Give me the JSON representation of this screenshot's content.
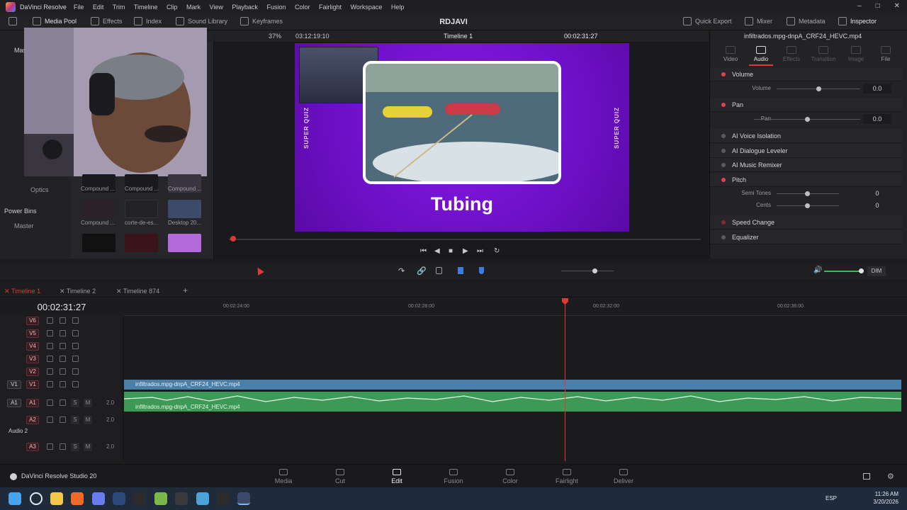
{
  "titlebar": {
    "app_name": "DaVinci Resolve",
    "menu": [
      "File",
      "Edit",
      "Trim",
      "Timeline",
      "Clip",
      "Mark",
      "View",
      "Playback",
      "Fusion",
      "Color",
      "Fairlight",
      "Workspace",
      "Help"
    ]
  },
  "toolbar": {
    "media_pool": "Media Pool",
    "effects": "Effects",
    "index": "Index",
    "sound_library": "Sound Library",
    "keyframes": "Keyframes",
    "project_title": "RDJAVI",
    "quick_export": "Quick Export",
    "mixer": "Mixer",
    "metadata": "Metadata",
    "inspector": "Inspector"
  },
  "media_pool": {
    "sidebar_truncated": "Mas",
    "optics": "Optics",
    "power_bins": "Power Bins",
    "master": "Master",
    "clips": [
      {
        "label": "Compound ...",
        "color": "#1a1a1c"
      },
      {
        "label": "Compound ...",
        "color": "#1a1a1c"
      },
      {
        "label": "Compound ...",
        "color": "#3a3440"
      },
      {
        "label": "Compound ...",
        "color": "#2a2226"
      },
      {
        "label": "corte-de-es...",
        "color": "#232326"
      },
      {
        "label": "Desktop 20...",
        "color": "#3d4a6a"
      },
      {
        "label": "",
        "color": "#111"
      },
      {
        "label": "",
        "color": "#3a1418"
      },
      {
        "label": "",
        "color": "#b46ad8"
      }
    ]
  },
  "viewer": {
    "zoom": "37%",
    "source_timecode": "03:12:19:10",
    "timeline_name": "Timeline 1",
    "record_timecode": "00:02:31:27",
    "overlay_title": "Tubing",
    "side_text": "SUPER QUIZ"
  },
  "inspector": {
    "clip_name": "infiltrados.mpg-dnpA_CRF24_HEVC.mp4",
    "tabs": [
      "Video",
      "Audio",
      "Effects",
      "Transition",
      "Image",
      "File"
    ],
    "active_tab": "Audio",
    "sections": {
      "volume": {
        "title": "Volume",
        "param": "Volume",
        "value": "0.0",
        "level": 0.5
      },
      "pan": {
        "title": "Pan",
        "param": "Pan",
        "value": "0.0",
        "level": 0.5
      },
      "voice_isolation": "AI Voice Isolation",
      "dialogue_leveler": "AI Dialogue Leveler",
      "music_remixer": "AI Music Remixer",
      "pitch": {
        "title": "Pitch",
        "semitones_label": "Semi Tones",
        "semitones_value": "0",
        "cents_label": "Cents",
        "cents_value": "0"
      },
      "speed_change": "Speed Change",
      "equalizer": "Equalizer"
    }
  },
  "timeline_toolbar": {
    "dim": "DIM"
  },
  "timeline_tabs": [
    "Timeline 1",
    "Timeline 2",
    "Timeline 874"
  ],
  "timeline": {
    "timecode": "00:02:31:27",
    "ruler": [
      "00:02:24:00",
      "00:02:28:00",
      "00:02:32:00",
      "00:02:36:00"
    ],
    "video_tracks": [
      "V6",
      "V5",
      "V4",
      "V3",
      "V2",
      "V1"
    ],
    "v1_button": "V1",
    "audio": {
      "a1_button": "A1",
      "a1": "A1",
      "a1_level": "2.0",
      "a2": "A2",
      "a2_level": "2.0",
      "a2_name": "Audio 2",
      "a3": "A3",
      "a3_level": "2.0",
      "solo": "S",
      "mute": "M"
    },
    "clip_video_name": "infiltrados.mpg-dnpA_CRF24_HEVC.mp4",
    "clip_audio_name": "infiltrados.mpg-dnpA_CRF24_HEVC.mp4"
  },
  "pagenav": {
    "brand": "DaVinci Resolve Studio 20",
    "pages": [
      "Media",
      "Cut",
      "Edit",
      "Fusion",
      "Color",
      "Fairlight",
      "Deliver"
    ],
    "active": "Edit"
  },
  "taskbar": {
    "lang": "ESP",
    "time": "11:26 AM",
    "date": "3/20/2026"
  }
}
